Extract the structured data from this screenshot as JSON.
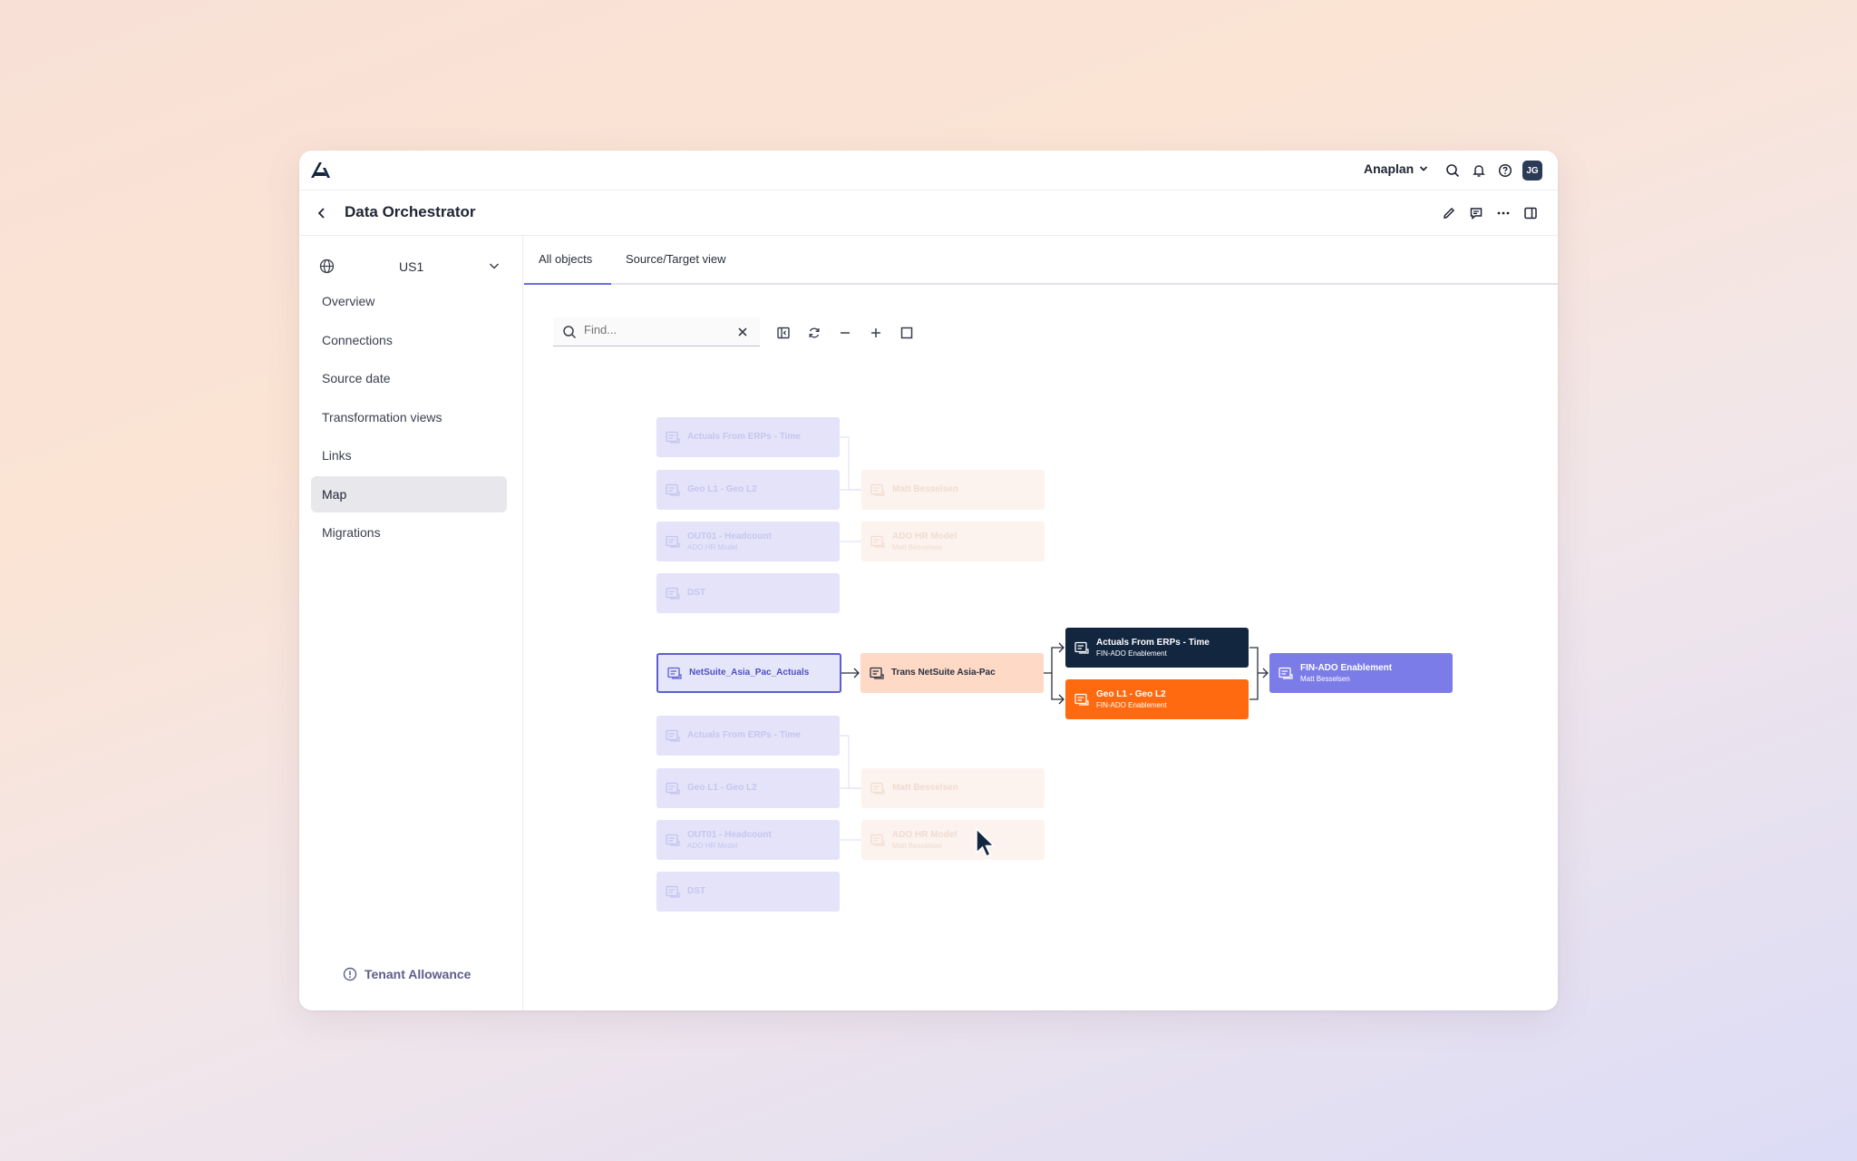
{
  "app": {
    "tenant": "Anaplan",
    "user_initials": "JG"
  },
  "page": {
    "title": "Data Orchestrator"
  },
  "sidebar": {
    "region": "US1",
    "items": [
      {
        "label": "Overview"
      },
      {
        "label": "Connections"
      },
      {
        "label": "Source date"
      },
      {
        "label": "Transformation views"
      },
      {
        "label": "Links"
      },
      {
        "label": "Map",
        "active": true
      },
      {
        "label": "Migrations"
      }
    ],
    "footer": "Tenant Allowance"
  },
  "tabs": [
    {
      "label": "All objects",
      "active": true
    },
    {
      "label": "Source/Target view"
    }
  ],
  "search": {
    "placeholder": "Find..."
  },
  "map": {
    "faded_top": [
      {
        "title": "Actuals From ERPs - Time"
      },
      {
        "title": "Geo L1 - Geo L2"
      },
      {
        "title": "OUT01 - Headcount",
        "sub": "ADO HR Model"
      },
      {
        "title": "DST"
      }
    ],
    "faded_top_targets": [
      {
        "title": "Matt Besselsen"
      },
      {
        "title": "ADO HR Model",
        "sub": "Matt Besselsen"
      }
    ],
    "source": {
      "title": "NetSuite_Asia_Pac_Actuals"
    },
    "transform": {
      "title": "Trans NetSuite Asia-Pac"
    },
    "outputs": [
      {
        "title": "Actuals From ERPs - Time",
        "sub": "FIN-ADO Enablement"
      },
      {
        "title": "Geo L1 - Geo L2",
        "sub": "FIN-ADO Enablement"
      }
    ],
    "target": {
      "title": "FIN-ADO Enablement",
      "sub": "Matt Besselsen"
    },
    "faded_bottom": [
      {
        "title": "Actuals From ERPs - Time"
      },
      {
        "title": "Geo L1 - Geo L2"
      },
      {
        "title": "OUT01 - Headcount",
        "sub": "ADO HR Model"
      },
      {
        "title": "DST"
      }
    ],
    "faded_bottom_targets": [
      {
        "title": "Matt Besselsen"
      },
      {
        "title": "ADO HR Model",
        "sub": "Matt Besselsen"
      }
    ]
  },
  "colors": {
    "accent": "#6b6fe0",
    "dark_node": "#132640",
    "orange_node": "#ff6a10",
    "purple_node": "#7c7ce8",
    "transform_node": "#fdd9c6"
  }
}
